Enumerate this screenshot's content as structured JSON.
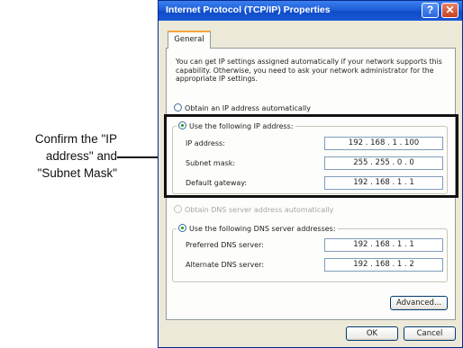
{
  "callout": {
    "lines": [
      "Confirm the \"IP",
      "address\" and",
      "\"Subnet Mask\""
    ]
  },
  "window": {
    "title": "Internet Protocol (TCP/IP) Properties",
    "help_label": "?",
    "close_label": "✕",
    "tab_general": "General"
  },
  "general": {
    "description": "You can get IP settings assigned automatically if your network supports this capability. Otherwise, you need to ask your network administrator for the appropriate IP settings.",
    "obtain_ip_auto": "Obtain an IP address automatically",
    "use_following_ip": "Use the following IP address:",
    "ip_address_label": "IP address:",
    "ip_address_value": "192 . 168 . 1 . 100",
    "subnet_mask_label": "Subnet mask:",
    "subnet_mask_value": "255 . 255 . 0 . 0",
    "default_gateway_label": "Default gateway:",
    "default_gateway_value": "192 . 168 . 1 . 1",
    "obtain_dns_auto": "Obtain DNS server address automatically",
    "use_following_dns": "Use the following DNS server addresses:",
    "preferred_dns_label": "Preferred DNS server:",
    "preferred_dns_value": "192 . 168 . 1 . 1",
    "alternate_dns_label": "Alternate DNS server:",
    "alternate_dns_value": "192 . 168 . 1 . 2",
    "advanced_label": "Advanced...",
    "ok_label": "OK",
    "cancel_label": "Cancel"
  }
}
